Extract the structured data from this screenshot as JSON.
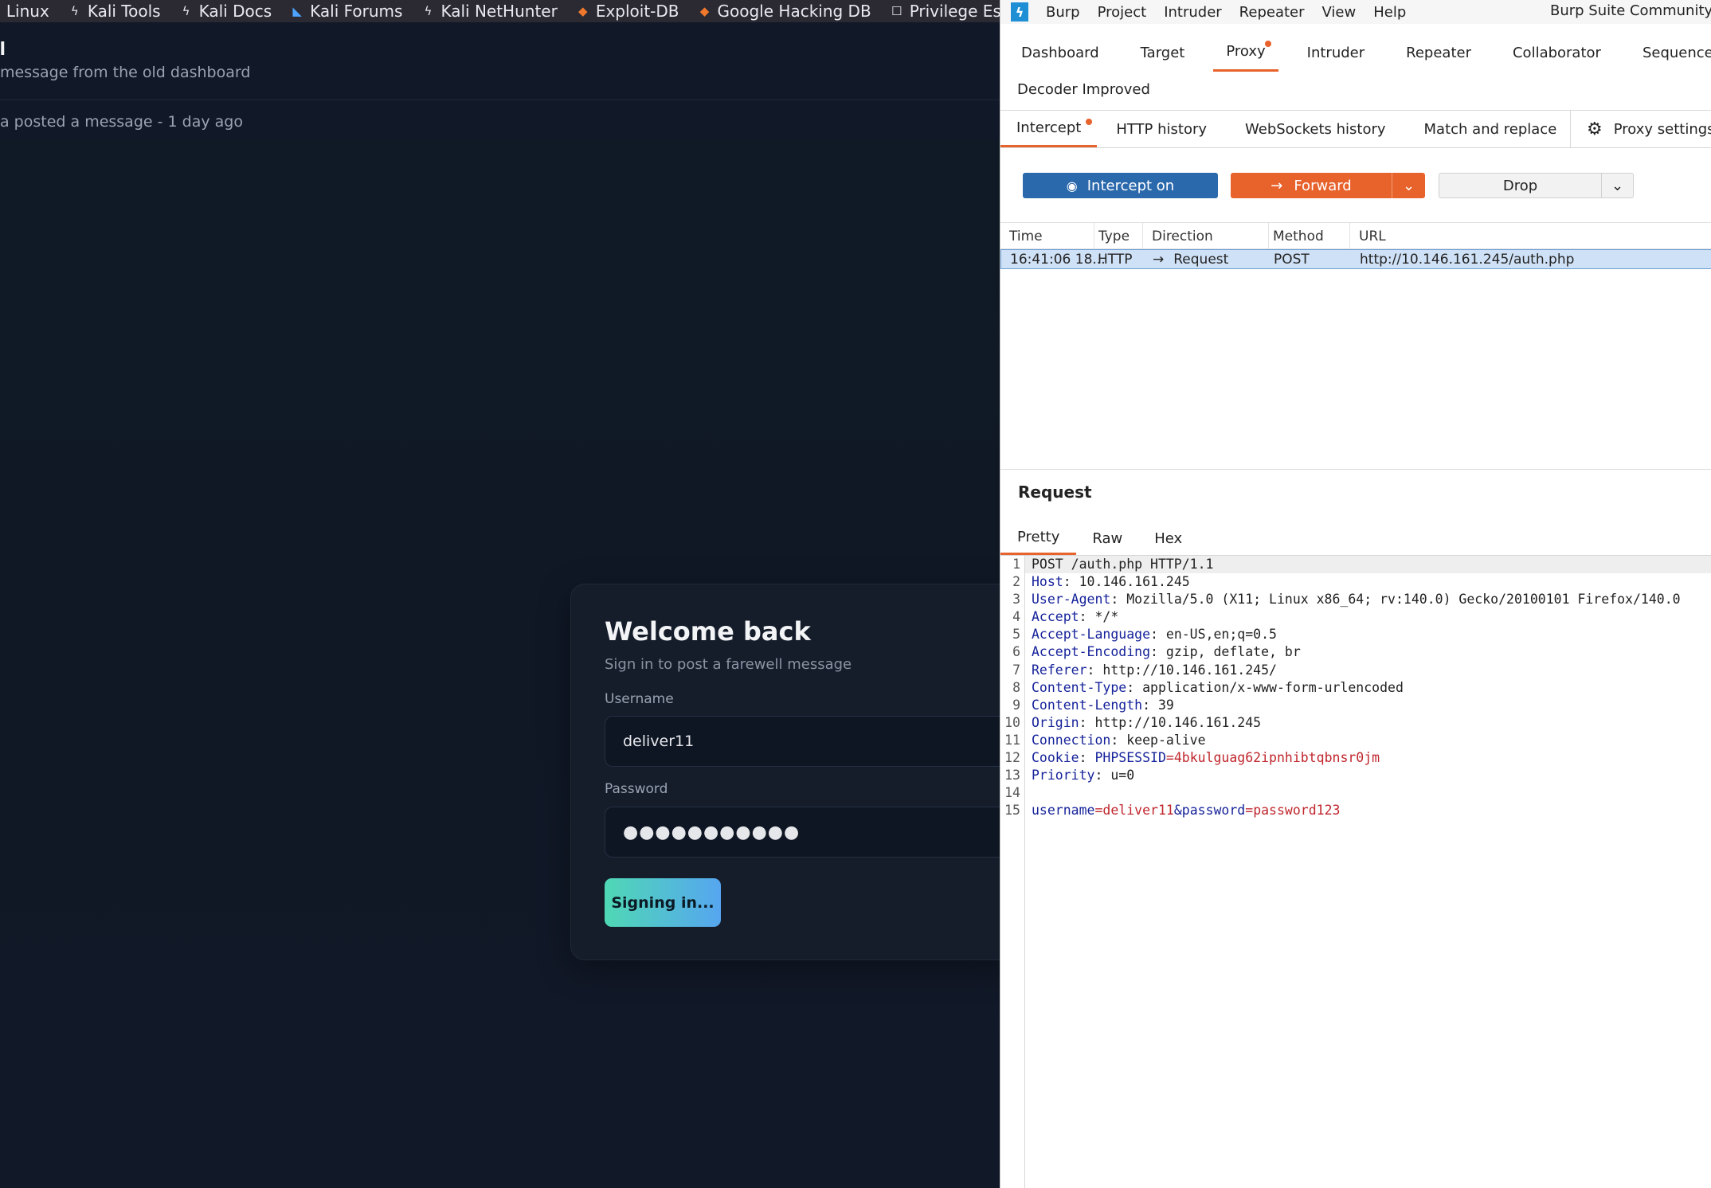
{
  "browser": {
    "bookmarks": [
      {
        "label": "i Linux",
        "icon": "kali-dragon-icon"
      },
      {
        "label": "Kali Tools",
        "icon": "kali-dragon-icon"
      },
      {
        "label": "Kali Docs",
        "icon": "kali-dragon-icon"
      },
      {
        "label": "Kali Forums",
        "icon": "kali-forums-icon"
      },
      {
        "label": "Kali NetHunter",
        "icon": "kali-dragon-icon"
      },
      {
        "label": "Exploit-DB",
        "icon": "exploit-db-icon"
      },
      {
        "label": "Google Hacking DB",
        "icon": "exploit-db-icon"
      },
      {
        "label": "Privilege Escal",
        "icon": "folder-icon"
      }
    ],
    "site_title": "ll",
    "site_subtitle": "message from the old dashboard",
    "activity": "a posted a message - 1 day ago",
    "login": {
      "heading": "Welcome back",
      "subheading": "Sign in to post a farewell message",
      "username_label": "Username",
      "username_value": "deliver11",
      "password_label": "Password",
      "password_value": "●●●●●●●●●●●",
      "submit_label": "Signing in..."
    }
  },
  "burp": {
    "menu": [
      "Burp",
      "Project",
      "Intruder",
      "Repeater",
      "View",
      "Help"
    ],
    "app_title": "Burp Suite Community Ed",
    "main_tabs": [
      "Dashboard",
      "Target",
      "Proxy",
      "Intruder",
      "Repeater",
      "Collaborator",
      "Sequencer"
    ],
    "main_tabs_row2": [
      "Decoder Improved"
    ],
    "proxy_tabs": [
      "Intercept",
      "HTTP history",
      "WebSockets history",
      "Match and replace"
    ],
    "proxy_settings_label": "Proxy settings",
    "intercept_label": "Intercept on",
    "forward_label": "Forward",
    "drop_label": "Drop",
    "table": {
      "headers": [
        "Time",
        "Type",
        "Direction",
        "Method",
        "URL"
      ],
      "rows": [
        {
          "time": "16:41:06 18...",
          "type": "HTTP",
          "direction": "Request",
          "method": "POST",
          "url": "http://10.146.161.245/auth.php"
        }
      ]
    },
    "request_title": "Request",
    "request_tabs": [
      "Pretty",
      "Raw",
      "Hex"
    ],
    "request_lines": {
      "l1": "POST /auth.php HTTP/1.1",
      "l2k": "Host",
      "l2v": ": 10.146.161.245",
      "l3k": "User-Agent",
      "l3v": ": Mozilla/5.0 (X11; Linux x86_64; rv:140.0) Gecko/20100101 Firefox/140.0",
      "l4k": "Accept",
      "l4v": ": */*",
      "l5k": "Accept-Language",
      "l5v": ": en-US,en;q=0.5",
      "l6k": "Accept-Encoding",
      "l6v": ": gzip, deflate, br",
      "l7k": "Referer",
      "l7v": ": http://10.146.161.245/",
      "l8k": "Content-Type",
      "l8v": ": application/x-www-form-urlencoded",
      "l9k": "Content-Length",
      "l9v": ": 39",
      "l10k": "Origin",
      "l10v": ": http://10.146.161.245",
      "l11k": "Connection",
      "l11v": ": keep-alive",
      "l12k": "Cookie",
      "l12sep": ": ",
      "l12ck": "PHPSESSID",
      "l12eq": "=",
      "l12cv": "4bkulguag62ipnhibtqbnsr0jm",
      "l13k": "Priority",
      "l13v": ": u=0",
      "l15k1": "username",
      "l15eq1": "=",
      "l15v1": "deliver11",
      "l15amp": "&",
      "l15k2": "password",
      "l15eq2": "=",
      "l15v2": "password123"
    },
    "line_numbers": [
      "1",
      "2",
      "3",
      "4",
      "5",
      "6",
      "7",
      "8",
      "9",
      "10",
      "11",
      "12",
      "13",
      "14",
      "15"
    ]
  }
}
